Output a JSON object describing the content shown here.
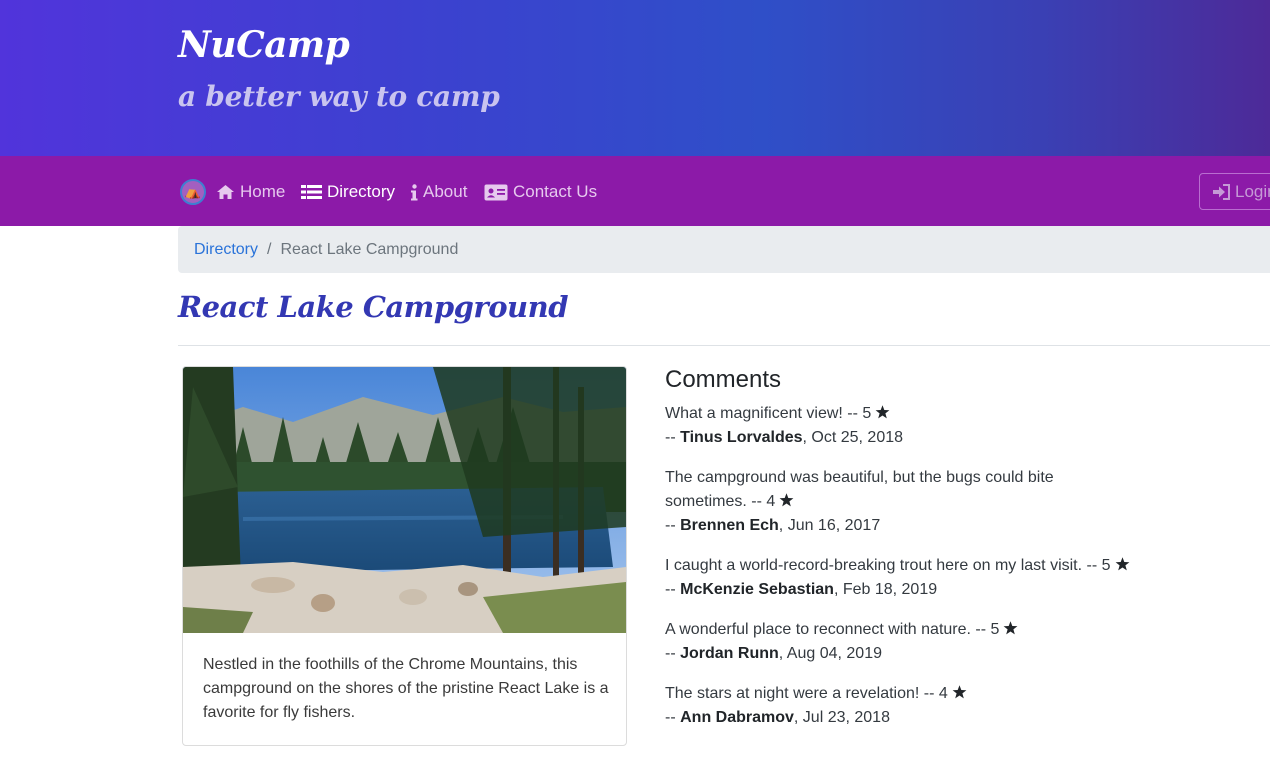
{
  "header": {
    "title": "NuCamp",
    "subtitle": "a better way to camp"
  },
  "nav": {
    "items": [
      {
        "label": "Home",
        "icon": "home-icon",
        "active": false
      },
      {
        "label": "Directory",
        "icon": "list-icon",
        "active": true
      },
      {
        "label": "About",
        "icon": "info-icon",
        "active": false
      },
      {
        "label": "Contact Us",
        "icon": "address-card-icon",
        "active": false
      }
    ],
    "login_label": "Login"
  },
  "breadcrumb": {
    "link": "Directory",
    "separator": "/",
    "current": "React Lake Campground"
  },
  "page": {
    "title": "React Lake Campground"
  },
  "campsite": {
    "image_alt": "React Lake Campground",
    "description": "Nestled in the foothills of the Chrome Mountains, this campground on the shores of the pristine React Lake is a favorite for fly fishers."
  },
  "comments": {
    "heading": "Comments",
    "items": [
      {
        "text": "What a magnificent view!",
        "rating": "5",
        "author": "Tinus Lorvaldes",
        "date": "Oct 25, 2018"
      },
      {
        "text": "The campground was beautiful, but the bugs could bite sometimes.",
        "rating": "4",
        "author": "Brennen Ech",
        "date": "Jun 16, 2017"
      },
      {
        "text": "I caught a world-record-breaking trout here on my last visit.",
        "rating": "5",
        "author": "McKenzie Sebastian",
        "date": "Feb 18, 2019"
      },
      {
        "text": "A wonderful place to reconnect with nature.",
        "rating": "5",
        "author": "Jordan Runn",
        "date": "Aug 04, 2019"
      },
      {
        "text": "The stars at night were a revelation!",
        "rating": "4",
        "author": "Ann Dabramov",
        "date": "Jul 23, 2018"
      }
    ]
  },
  "colors": {
    "jumbotron": "#3b42cf",
    "navbar": "#8c1aa8",
    "title_accent": "#3338b3",
    "link": "#2a73d9"
  }
}
